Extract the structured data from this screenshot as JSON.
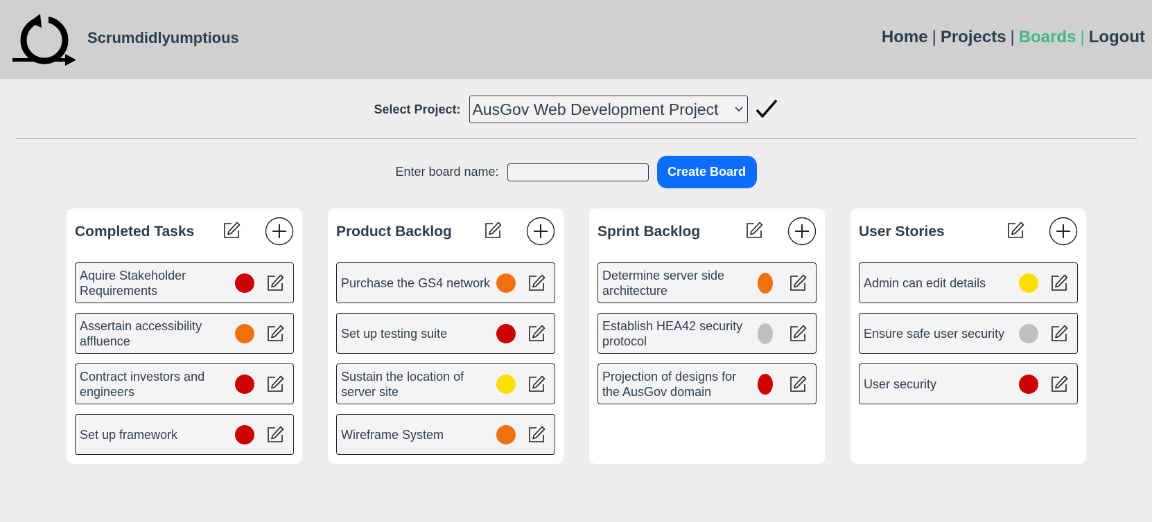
{
  "header": {
    "app_name": "Scrumdidlyumptious",
    "nav": [
      {
        "label": "Home",
        "active": false
      },
      {
        "label": "Projects",
        "active": false
      },
      {
        "label": "Boards",
        "active": true
      },
      {
        "label": "Logout",
        "active": false
      }
    ],
    "separator": "|"
  },
  "project_select": {
    "label": "Select Project:",
    "value": "AusGov Web Development Project"
  },
  "create_board": {
    "label": "Enter board name:",
    "value": "",
    "button_label": "Create Board"
  },
  "colors": {
    "red": "#cc0000",
    "orange": "#f07010",
    "yellow": "#ffdd00",
    "grey": "#c0c0c0",
    "accent": "#42b983",
    "button": "#0d6efd"
  },
  "boards": [
    {
      "title": "Completed Tasks",
      "tasks": [
        {
          "name": "Aquire Stakeholder Requirements",
          "priority": "red",
          "color": "#cc0000"
        },
        {
          "name": "Assertain accessibility affluence",
          "priority": "orange",
          "color": "#f07010"
        },
        {
          "name": "Contract investors and engineers",
          "priority": "red",
          "color": "#cc0000"
        },
        {
          "name": "Set up framework",
          "priority": "red",
          "color": "#cc0000"
        }
      ]
    },
    {
      "title": "Product Backlog",
      "tasks": [
        {
          "name": "Purchase the GS4 network",
          "priority": "orange",
          "color": "#f07010"
        },
        {
          "name": "Set up testing suite",
          "priority": "red",
          "color": "#cc0000"
        },
        {
          "name": "Sustain the location of server site",
          "priority": "yellow",
          "color": "#ffdd00"
        },
        {
          "name": "Wireframe System",
          "priority": "orange",
          "color": "#f07010"
        }
      ]
    },
    {
      "title": "Sprint Backlog",
      "tasks": [
        {
          "name": "Determine server side architecture",
          "priority": "orange",
          "color": "#f07010"
        },
        {
          "name": "Establish HEA42 security protocol",
          "priority": "grey",
          "color": "#c0c0c0"
        },
        {
          "name": "Projection of designs for the AusGov domain",
          "priority": "red",
          "color": "#cc0000"
        }
      ]
    },
    {
      "title": "User Stories",
      "tasks": [
        {
          "name": "Admin can edit details",
          "priority": "yellow",
          "color": "#ffdd00"
        },
        {
          "name": "Ensure safe user security",
          "priority": "grey",
          "color": "#c0c0c0"
        },
        {
          "name": "User security",
          "priority": "red",
          "color": "#cc0000"
        }
      ]
    }
  ]
}
